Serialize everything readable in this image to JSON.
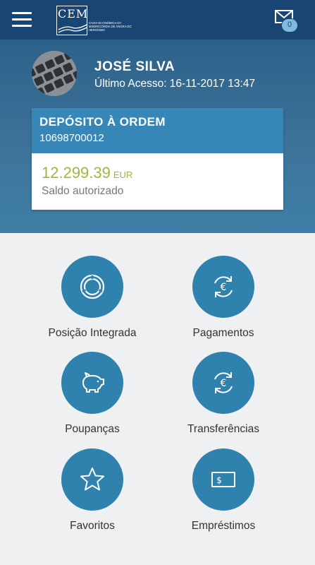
{
  "topbar": {
    "logo_text": "CEM",
    "logo_subtitle": "Caixa Económica da Misericórdia de Angra do Heroísmo",
    "mail_count": "0"
  },
  "user": {
    "name": "JOSÉ SILVA",
    "last_access": "Último Acesso: 16-11-2017 13:47"
  },
  "account": {
    "type": "DEPÓSITO À ORDEM",
    "number": "10698700012",
    "balance": "12.299.39",
    "currency": "EUR",
    "balance_label": "Saldo autorizado"
  },
  "menu": {
    "items": [
      {
        "label": "Posição Integrada",
        "icon": "pie-chart-icon"
      },
      {
        "label": "Pagamentos",
        "icon": "euro-cycle-icon"
      },
      {
        "label": "Poupanças",
        "icon": "piggy-bank-icon"
      },
      {
        "label": "Transferências",
        "icon": "euro-cycle-icon"
      },
      {
        "label": "Favoritos",
        "icon": "star-icon"
      },
      {
        "label": "Empréstimos",
        "icon": "banknote-icon"
      }
    ]
  },
  "colors": {
    "topbar": "#184574",
    "header": "#3d7399",
    "accent": "#2f82ad",
    "balance": "#a4b53c"
  }
}
